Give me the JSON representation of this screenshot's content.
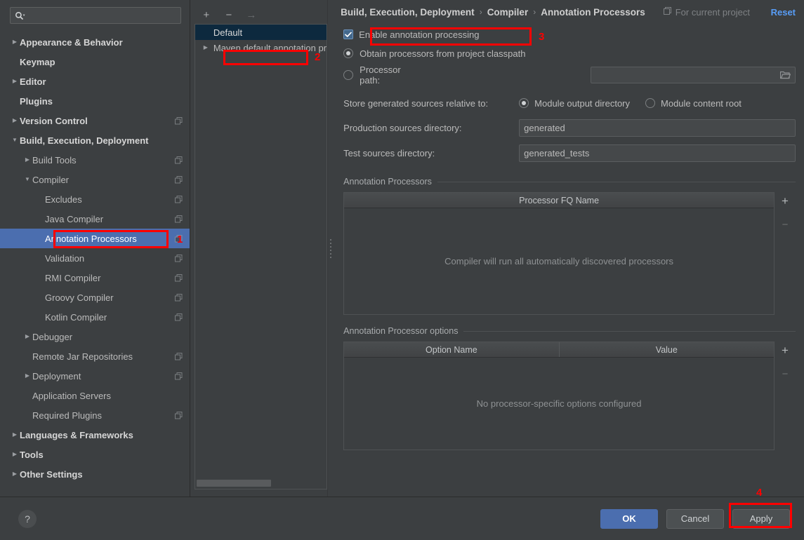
{
  "search": {
    "placeholder": "",
    "value": "",
    "icon": "search-icon"
  },
  "sidebar": {
    "items": [
      {
        "label": "Appearance & Behavior",
        "indent": 0,
        "arrow": "collapsed",
        "bold": true,
        "badge": false,
        "selected": false
      },
      {
        "label": "Keymap",
        "indent": 0,
        "arrow": "none",
        "bold": true,
        "badge": false,
        "selected": false
      },
      {
        "label": "Editor",
        "indent": 0,
        "arrow": "collapsed",
        "bold": true,
        "badge": false,
        "selected": false
      },
      {
        "label": "Plugins",
        "indent": 0,
        "arrow": "none",
        "bold": true,
        "badge": false,
        "selected": false
      },
      {
        "label": "Version Control",
        "indent": 0,
        "arrow": "collapsed",
        "bold": true,
        "badge": true,
        "selected": false
      },
      {
        "label": "Build, Execution, Deployment",
        "indent": 0,
        "arrow": "expanded",
        "bold": true,
        "badge": false,
        "selected": false
      },
      {
        "label": "Build Tools",
        "indent": 1,
        "arrow": "collapsed",
        "bold": false,
        "badge": true,
        "selected": false
      },
      {
        "label": "Compiler",
        "indent": 1,
        "arrow": "expanded",
        "bold": false,
        "badge": true,
        "selected": false
      },
      {
        "label": "Excludes",
        "indent": 2,
        "arrow": "none",
        "bold": false,
        "badge": true,
        "selected": false
      },
      {
        "label": "Java Compiler",
        "indent": 2,
        "arrow": "none",
        "bold": false,
        "badge": true,
        "selected": false
      },
      {
        "label": "Annotation Processors",
        "indent": 2,
        "arrow": "none",
        "bold": false,
        "badge": true,
        "selected": true
      },
      {
        "label": "Validation",
        "indent": 2,
        "arrow": "none",
        "bold": false,
        "badge": true,
        "selected": false
      },
      {
        "label": "RMI Compiler",
        "indent": 2,
        "arrow": "none",
        "bold": false,
        "badge": true,
        "selected": false
      },
      {
        "label": "Groovy Compiler",
        "indent": 2,
        "arrow": "none",
        "bold": false,
        "badge": true,
        "selected": false
      },
      {
        "label": "Kotlin Compiler",
        "indent": 2,
        "arrow": "none",
        "bold": false,
        "badge": true,
        "selected": false
      },
      {
        "label": "Debugger",
        "indent": 1,
        "arrow": "collapsed",
        "bold": false,
        "badge": false,
        "selected": false
      },
      {
        "label": "Remote Jar Repositories",
        "indent": 1,
        "arrow": "none",
        "bold": false,
        "badge": true,
        "selected": false
      },
      {
        "label": "Deployment",
        "indent": 1,
        "arrow": "collapsed",
        "bold": false,
        "badge": true,
        "selected": false
      },
      {
        "label": "Application Servers",
        "indent": 1,
        "arrow": "none",
        "bold": false,
        "badge": false,
        "selected": false
      },
      {
        "label": "Required Plugins",
        "indent": 1,
        "arrow": "none",
        "bold": false,
        "badge": true,
        "selected": false
      },
      {
        "label": "Languages & Frameworks",
        "indent": 0,
        "arrow": "collapsed",
        "bold": true,
        "badge": false,
        "selected": false
      },
      {
        "label": "Tools",
        "indent": 0,
        "arrow": "collapsed",
        "bold": true,
        "badge": false,
        "selected": false
      },
      {
        "label": "Other Settings",
        "indent": 0,
        "arrow": "collapsed",
        "bold": true,
        "badge": false,
        "selected": false
      }
    ]
  },
  "profiles": {
    "toolbar": {
      "add": "+",
      "remove": "−",
      "move": "→"
    },
    "items": [
      {
        "label": "Default",
        "arrow": "none",
        "selected": true
      },
      {
        "label": "Maven default annotation pr",
        "arrow": "collapsed",
        "selected": false
      }
    ]
  },
  "header": {
    "crumbs": [
      "Build, Execution, Deployment",
      "Compiler",
      "Annotation Processors"
    ],
    "separator": "›",
    "scope_note": "For current project",
    "reset_label": "Reset"
  },
  "settings": {
    "enable_label": "Enable annotation processing",
    "enable_checked": true,
    "source_options": [
      {
        "label": "Obtain processors from project classpath",
        "selected": true
      },
      {
        "label": "Processor path:",
        "selected": false
      }
    ],
    "processor_path_value": "",
    "store_label": "Store generated sources relative to:",
    "store_options": [
      {
        "label": "Module output directory",
        "selected": true
      },
      {
        "label": "Module content root",
        "selected": false
      }
    ],
    "production_label": "Production sources directory:",
    "production_value": "generated",
    "test_label": "Test sources directory:",
    "test_value": "generated_tests",
    "processors_group": {
      "title": "Annotation Processors",
      "columns": [
        "Processor FQ Name"
      ],
      "empty_text": "Compiler will run all automatically discovered processors",
      "add": "+",
      "remove": "−"
    },
    "options_group": {
      "title": "Annotation Processor options",
      "columns": [
        "Option Name",
        "Value"
      ],
      "empty_text": "No processor-specific options configured",
      "add": "+",
      "remove": "−"
    }
  },
  "footer": {
    "help_label": "?",
    "ok_label": "OK",
    "cancel_label": "Cancel",
    "apply_label": "Apply"
  },
  "annotations": {
    "accent_color": "#ff0000",
    "markers": [
      {
        "number": "1",
        "target": "sidebar-item-annotation-processors"
      },
      {
        "number": "2",
        "target": "profile-item-default"
      },
      {
        "number": "3",
        "target": "enable-annotation-processing-checkbox"
      },
      {
        "number": "4",
        "target": "apply-button"
      }
    ]
  }
}
